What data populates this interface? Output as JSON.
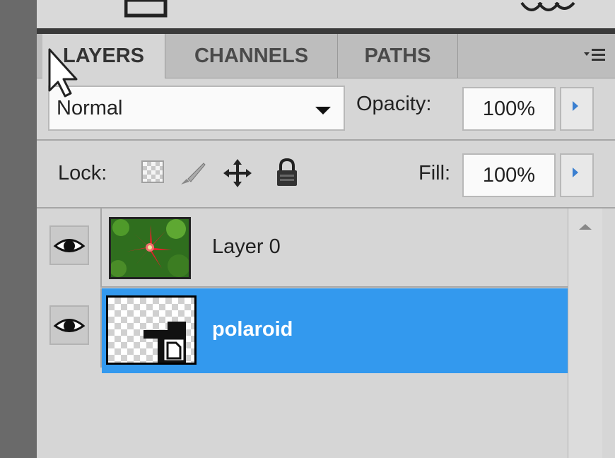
{
  "tabs": [
    {
      "label": "LAYERS",
      "active": true
    },
    {
      "label": "CHANNELS",
      "active": false
    },
    {
      "label": "PATHS",
      "active": false
    }
  ],
  "blend_mode": {
    "value": "Normal"
  },
  "opacity": {
    "label": "Opacity:",
    "value": "100%"
  },
  "lock": {
    "label": "Lock:"
  },
  "fill": {
    "label": "Fill:",
    "value": "100%"
  },
  "layers": [
    {
      "name": "Layer 0",
      "visible": true,
      "selected": false
    },
    {
      "name": "polaroid",
      "visible": true,
      "selected": true
    }
  ],
  "colors": {
    "selection": "#3399ee",
    "panel_bg": "#d6d6d6",
    "tab_inactive": "#bdbdbd"
  },
  "icons": [
    "panel-menu-icon",
    "lock-transparent-pixels-icon",
    "lock-image-pixels-icon",
    "lock-position-icon",
    "lock-all-icon",
    "eye-icon",
    "mouse-cursor-icon",
    "scroll-up-icon"
  ]
}
